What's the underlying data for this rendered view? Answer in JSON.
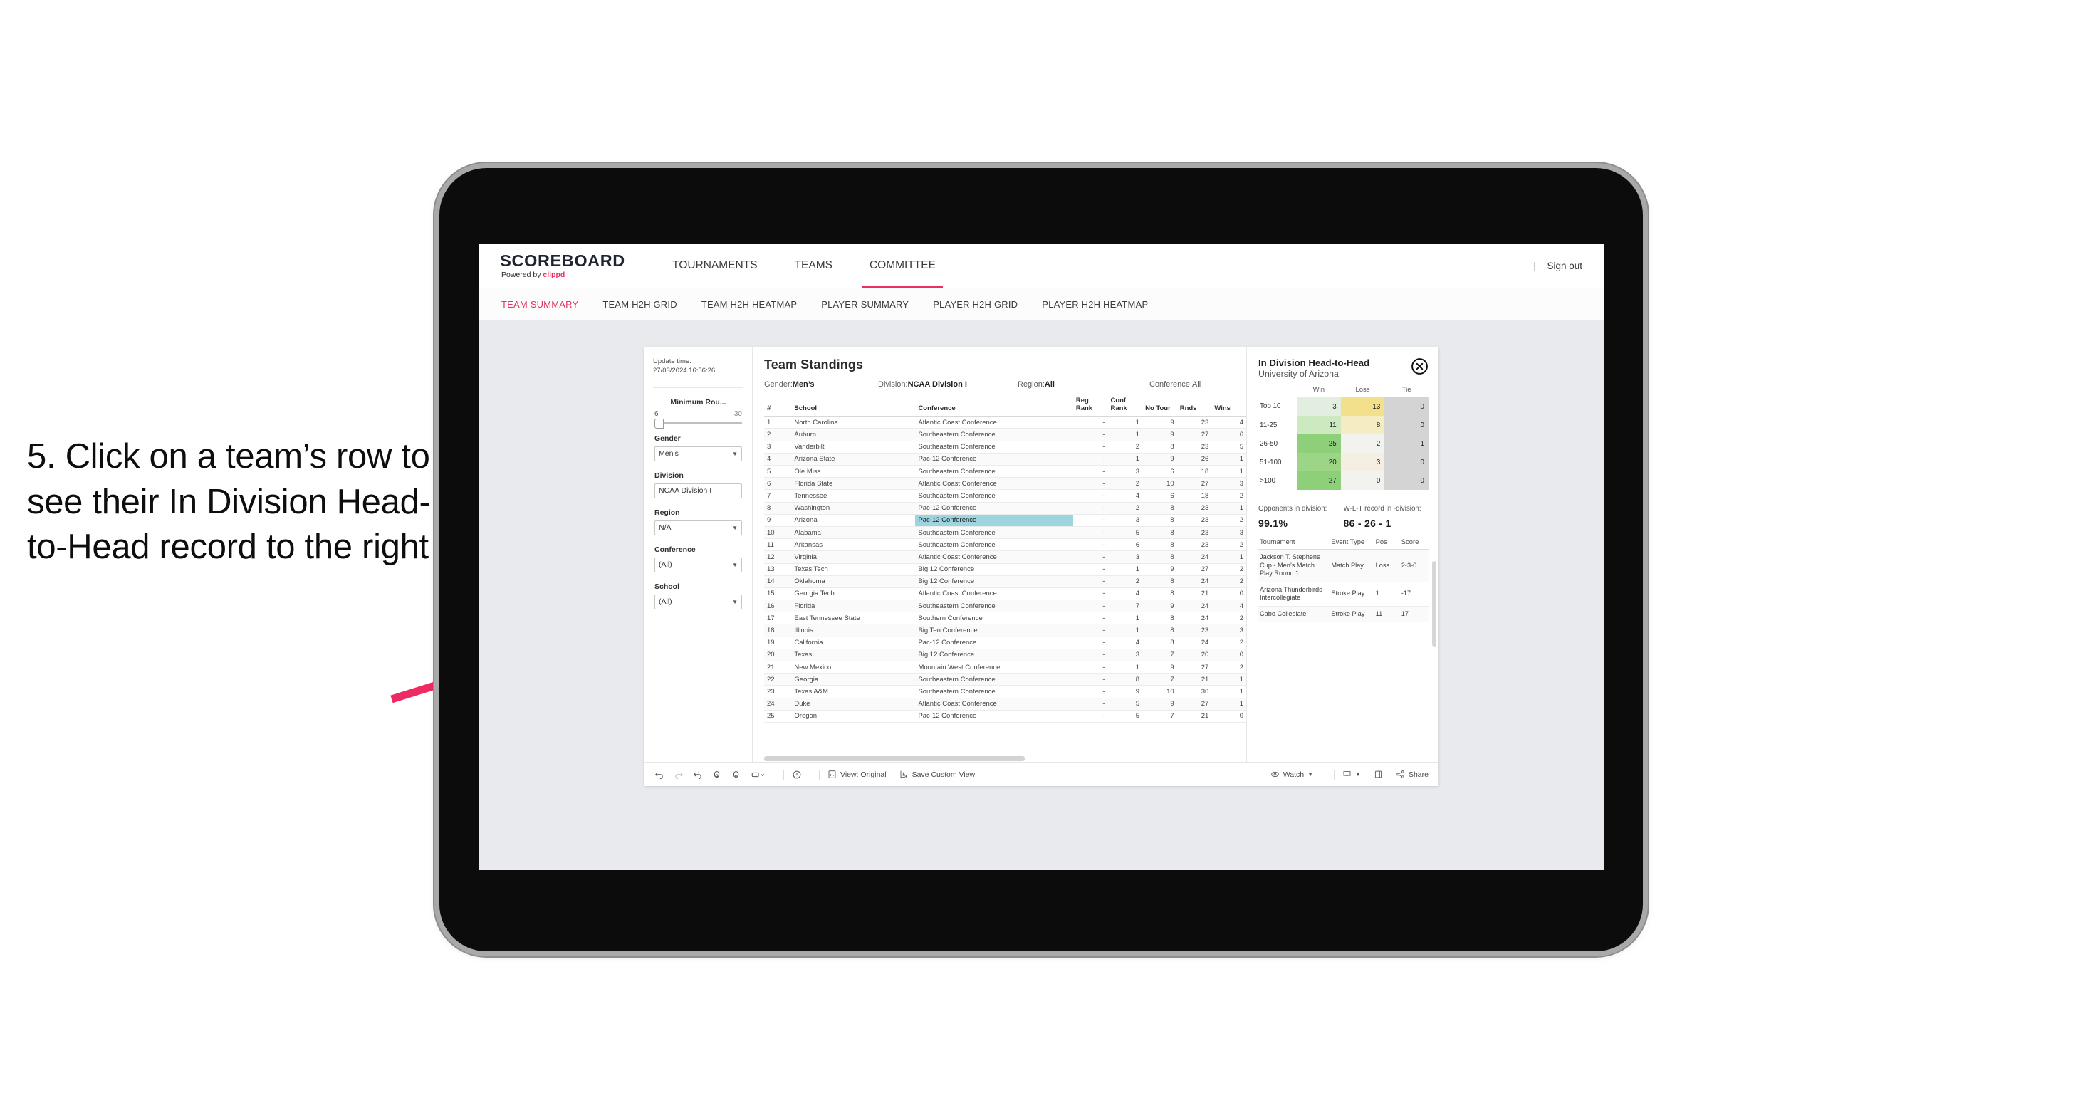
{
  "annotation": {
    "text": "5. Click on a team’s row to see their In Division Head-to-Head record to the right",
    "arrow_color": "#ee2a62"
  },
  "topnav": {
    "logo": "SCOREBOARD",
    "logo_powered_prefix": "Powered by ",
    "logo_powered_brand": "clippd",
    "items": [
      {
        "label": "TOURNAMENTS",
        "active": false
      },
      {
        "label": "TEAMS",
        "active": false
      },
      {
        "label": "COMMITTEE",
        "active": true
      }
    ],
    "divider": "|",
    "signout": "Sign out",
    "accent": "#e8315f"
  },
  "subnav": {
    "items": [
      {
        "label": "TEAM SUMMARY",
        "active": true
      },
      {
        "label": "TEAM H2H GRID",
        "active": false
      },
      {
        "label": "TEAM H2H HEATMAP",
        "active": false
      },
      {
        "label": "PLAYER SUMMARY",
        "active": false
      },
      {
        "label": "PLAYER H2H GRID",
        "active": false
      },
      {
        "label": "PLAYER H2H HEATMAP",
        "active": false
      }
    ]
  },
  "filters": {
    "update_label": "Update time:",
    "update_value": "27/03/2024 16:56:26",
    "slider": {
      "label": "Minimum Rou...",
      "min": "6",
      "max": "30"
    },
    "groups": [
      {
        "label": "Gender",
        "value": "Men’s"
      },
      {
        "label": "Division",
        "value": "NCAA Division I"
      },
      {
        "label": "Region",
        "value": "N/A"
      },
      {
        "label": "Conference",
        "value": "(All)"
      },
      {
        "label": "School",
        "value": "(All)"
      }
    ]
  },
  "standings": {
    "title": "Team Standings",
    "meta": [
      {
        "label": "Gender: ",
        "value": "Men’s"
      },
      {
        "label": "Division: ",
        "value": "NCAA Division I"
      },
      {
        "label": "Region: ",
        "value": "All"
      },
      {
        "label": "Conference: ",
        "value": "All"
      }
    ],
    "columns": [
      "#",
      "School",
      "Conference",
      "Reg Rank",
      "Conf Rank",
      "No Tour",
      "Rnds",
      "Wins"
    ],
    "highlight_row": 9,
    "rows": [
      {
        "n": "1",
        "school": "North Carolina",
        "conf": "Atlantic Coast Conference",
        "reg": "-",
        "crank": "1",
        "notour": "9",
        "rnds": "23",
        "wins": "4"
      },
      {
        "n": "2",
        "school": "Auburn",
        "conf": "Southeastern Conference",
        "reg": "-",
        "crank": "1",
        "notour": "9",
        "rnds": "27",
        "wins": "6"
      },
      {
        "n": "3",
        "school": "Vanderbilt",
        "conf": "Southeastern Conference",
        "reg": "-",
        "crank": "2",
        "notour": "8",
        "rnds": "23",
        "wins": "5"
      },
      {
        "n": "4",
        "school": "Arizona State",
        "conf": "Pac-12 Conference",
        "reg": "-",
        "crank": "1",
        "notour": "9",
        "rnds": "26",
        "wins": "1"
      },
      {
        "n": "5",
        "school": "Ole Miss",
        "conf": "Southeastern Conference",
        "reg": "-",
        "crank": "3",
        "notour": "6",
        "rnds": "18",
        "wins": "1"
      },
      {
        "n": "6",
        "school": "Florida State",
        "conf": "Atlantic Coast Conference",
        "reg": "-",
        "crank": "2",
        "notour": "10",
        "rnds": "27",
        "wins": "3"
      },
      {
        "n": "7",
        "school": "Tennessee",
        "conf": "Southeastern Conference",
        "reg": "-",
        "crank": "4",
        "notour": "6",
        "rnds": "18",
        "wins": "2"
      },
      {
        "n": "8",
        "school": "Washington",
        "conf": "Pac-12 Conference",
        "reg": "-",
        "crank": "2",
        "notour": "8",
        "rnds": "23",
        "wins": "1"
      },
      {
        "n": "9",
        "school": "Arizona",
        "conf": "Pac-12 Conference",
        "reg": "-",
        "crank": "3",
        "notour": "8",
        "rnds": "23",
        "wins": "2"
      },
      {
        "n": "10",
        "school": "Alabama",
        "conf": "Southeastern Conference",
        "reg": "-",
        "crank": "5",
        "notour": "8",
        "rnds": "23",
        "wins": "3"
      },
      {
        "n": "11",
        "school": "Arkansas",
        "conf": "Southeastern Conference",
        "reg": "-",
        "crank": "6",
        "notour": "8",
        "rnds": "23",
        "wins": "2"
      },
      {
        "n": "12",
        "school": "Virginia",
        "conf": "Atlantic Coast Conference",
        "reg": "-",
        "crank": "3",
        "notour": "8",
        "rnds": "24",
        "wins": "1"
      },
      {
        "n": "13",
        "school": "Texas Tech",
        "conf": "Big 12 Conference",
        "reg": "-",
        "crank": "1",
        "notour": "9",
        "rnds": "27",
        "wins": "2"
      },
      {
        "n": "14",
        "school": "Oklahoma",
        "conf": "Big 12 Conference",
        "reg": "-",
        "crank": "2",
        "notour": "8",
        "rnds": "24",
        "wins": "2"
      },
      {
        "n": "15",
        "school": "Georgia Tech",
        "conf": "Atlantic Coast Conference",
        "reg": "-",
        "crank": "4",
        "notour": "8",
        "rnds": "21",
        "wins": "0"
      },
      {
        "n": "16",
        "school": "Florida",
        "conf": "Southeastern Conference",
        "reg": "-",
        "crank": "7",
        "notour": "9",
        "rnds": "24",
        "wins": "4"
      },
      {
        "n": "17",
        "school": "East Tennessee State",
        "conf": "Southern Conference",
        "reg": "-",
        "crank": "1",
        "notour": "8",
        "rnds": "24",
        "wins": "2"
      },
      {
        "n": "18",
        "school": "Illinois",
        "conf": "Big Ten Conference",
        "reg": "-",
        "crank": "1",
        "notour": "8",
        "rnds": "23",
        "wins": "3"
      },
      {
        "n": "19",
        "school": "California",
        "conf": "Pac-12 Conference",
        "reg": "-",
        "crank": "4",
        "notour": "8",
        "rnds": "24",
        "wins": "2"
      },
      {
        "n": "20",
        "school": "Texas",
        "conf": "Big 12 Conference",
        "reg": "-",
        "crank": "3",
        "notour": "7",
        "rnds": "20",
        "wins": "0"
      },
      {
        "n": "21",
        "school": "New Mexico",
        "conf": "Mountain West Conference",
        "reg": "-",
        "crank": "1",
        "notour": "9",
        "rnds": "27",
        "wins": "2"
      },
      {
        "n": "22",
        "school": "Georgia",
        "conf": "Southeastern Conference",
        "reg": "-",
        "crank": "8",
        "notour": "7",
        "rnds": "21",
        "wins": "1"
      },
      {
        "n": "23",
        "school": "Texas A&M",
        "conf": "Southeastern Conference",
        "reg": "-",
        "crank": "9",
        "notour": "10",
        "rnds": "30",
        "wins": "1"
      },
      {
        "n": "24",
        "school": "Duke",
        "conf": "Atlantic Coast Conference",
        "reg": "-",
        "crank": "5",
        "notour": "9",
        "rnds": "27",
        "wins": "1"
      },
      {
        "n": "25",
        "school": "Oregon",
        "conf": "Pac-12 Conference",
        "reg": "-",
        "crank": "5",
        "notour": "7",
        "rnds": "21",
        "wins": "0"
      }
    ]
  },
  "detail": {
    "title": "In Division Head-to-Head",
    "subtitle": "University of Arizona",
    "close_icon": "close-circle-icon",
    "chart_data": {
      "type": "heatmap",
      "title": "In Division Head-to-Head",
      "subtitle": "University of Arizona",
      "columns": [
        "Win",
        "Loss",
        "Tie"
      ],
      "rows": [
        "Top 10",
        "11-25",
        "26-50",
        "51-100",
        ">100"
      ],
      "values": [
        [
          3,
          13,
          0
        ],
        [
          11,
          8,
          0
        ],
        [
          25,
          2,
          1
        ],
        [
          20,
          3,
          0
        ],
        [
          27,
          0,
          0
        ]
      ],
      "cell_colors": [
        [
          "#e2efe0",
          "#f2e08d",
          "#d4d4d4"
        ],
        [
          "#cde9bf",
          "#f5ecc2",
          "#d4d4d4"
        ],
        [
          "#8ed07a",
          "#f2f2ee",
          "#d4d4d4"
        ],
        [
          "#9dd587",
          "#f4efe2",
          "#d4d4d4"
        ],
        [
          "#8ed07a",
          "#f2f2ee",
          "#d4d4d4"
        ]
      ]
    },
    "kpis": [
      {
        "label": "Opponents in division:",
        "value": "99.1%"
      },
      {
        "label": "W-L-T record in -division:",
        "value": "86 - 26 - 1"
      }
    ],
    "tournament_columns": [
      "Tournament",
      "Event Type",
      "Pos",
      "Score"
    ],
    "tournaments": [
      {
        "name": "Jackson T. Stephens Cup - Men’s Match Play Round 1",
        "type": "Match Play",
        "pos": "Loss",
        "score": "2-3-0"
      },
      {
        "name": "Arizona Thunderbirds Intercollegiate",
        "type": "Stroke Play",
        "pos": "1",
        "score": "-17"
      },
      {
        "name": "Cabo Collegiate",
        "type": "Stroke Play",
        "pos": "11",
        "score": "17"
      }
    ]
  },
  "toolbar": {
    "icons": [
      "undo-icon",
      "redo-icon",
      "revert-icon",
      "refresh-data-icon",
      "pause-updates-icon",
      "shape-dropdown-icon",
      "history-icon"
    ],
    "view_label": "View: Original",
    "save_label": "Save Custom View",
    "watch_label": "Watch",
    "share_label": "Share",
    "download_icon": "download-icon",
    "fullscreen_icon": "fullscreen-icon"
  }
}
